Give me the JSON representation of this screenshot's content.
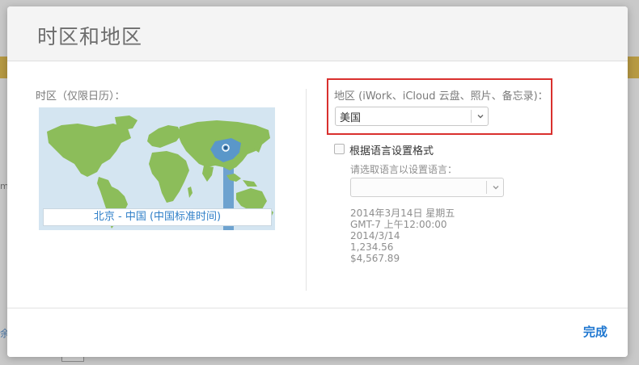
{
  "background": {
    "left_text": "m",
    "left_link": "余"
  },
  "dialog": {
    "title": "时区和地区",
    "timezone": {
      "label": "时区（仅限日历）：",
      "map_caption": "北京 - 中国 (中国标准时间)"
    },
    "region": {
      "label": "地区 (iWork、iCloud 云盘、照片、备忘录)：",
      "selected": "美国"
    },
    "format_by_language": {
      "checkbox_label": "根据语言设置格式",
      "checked": false,
      "language_prompt": "请选取语言以设置语言：",
      "language_selected": ""
    },
    "format_preview": {
      "line1": "2014年3月14日 星期五",
      "line2": "GMT-7 上午12:00:00",
      "line3": "2014/3/14",
      "line4": "1,234.56",
      "line5": "$4,567.89"
    },
    "done_label": "完成",
    "colors": {
      "accent": "#1f77d0",
      "highlight_border": "#d9302e",
      "land": "#8cbd5a",
      "selected_zone": "#5a97c9"
    }
  }
}
